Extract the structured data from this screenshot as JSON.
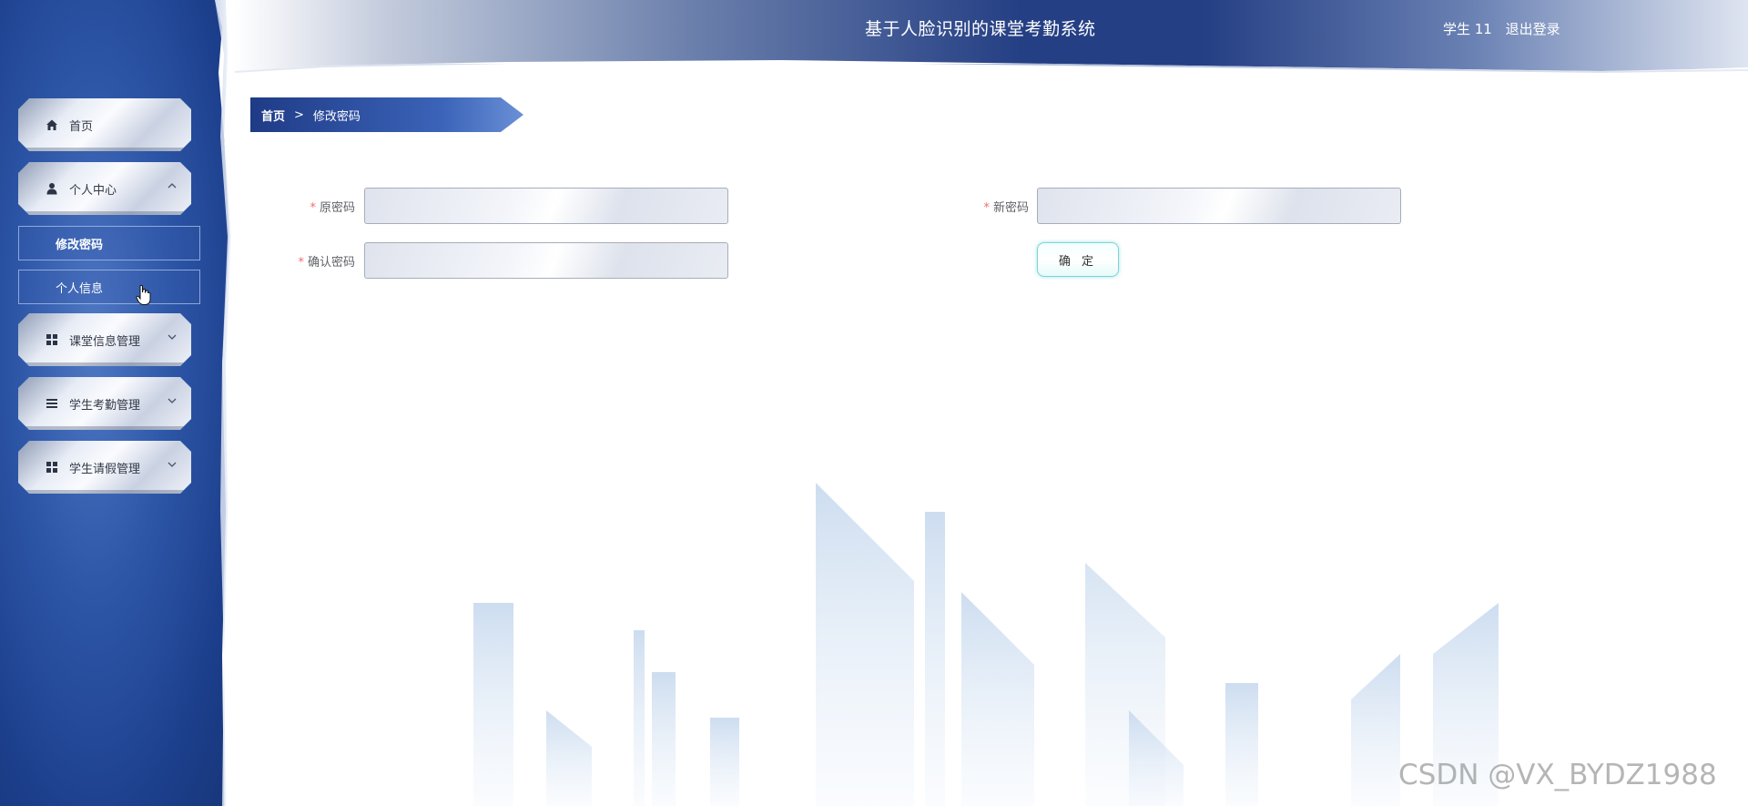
{
  "header": {
    "title": "基于人脸识别的课堂考勤系统",
    "user": "学生 11",
    "logout": "退出登录"
  },
  "sidebar": {
    "items": [
      {
        "label": "首页",
        "icon": "home-icon"
      },
      {
        "label": "个人中心",
        "icon": "user-icon",
        "expanded": true,
        "children": [
          {
            "label": "修改密码",
            "active": true
          },
          {
            "label": "个人信息"
          }
        ]
      },
      {
        "label": "课堂信息管理",
        "icon": "grid-icon"
      },
      {
        "label": "学生考勤管理",
        "icon": "list-icon"
      },
      {
        "label": "学生请假管理",
        "icon": "grid-icon"
      }
    ],
    "arrow_up": "⌃",
    "arrow_down": "⌄"
  },
  "breadcrumb": {
    "home": "首页",
    "separator": ">",
    "current": "修改密码"
  },
  "form": {
    "old_password": {
      "label": "原密码",
      "value": ""
    },
    "new_password": {
      "label": "新密码",
      "value": ""
    },
    "confirm_password": {
      "label": "确认密码",
      "value": ""
    },
    "required_mark": "*",
    "submit": "确 定"
  },
  "watermark": "CSDN @VX_BYDZ1988"
}
